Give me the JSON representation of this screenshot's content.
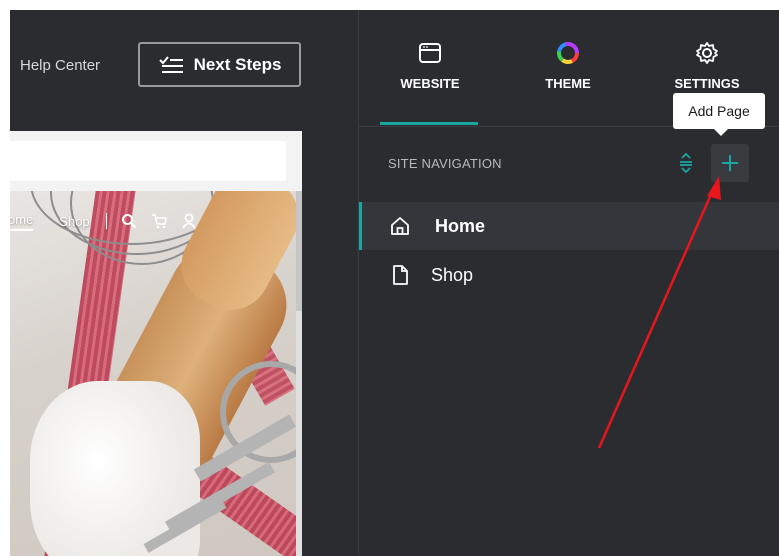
{
  "topbar": {
    "help_center": "Help Center",
    "next_steps": "Next Steps"
  },
  "preview": {
    "nav": {
      "home": "ome",
      "shop": "Shop"
    }
  },
  "panel": {
    "tabs": [
      {
        "label": "WEBSITE",
        "icon": "browser-window-icon",
        "active": true
      },
      {
        "label": "THEME",
        "icon": "color-wheel-icon",
        "active": false
      },
      {
        "label": "SETTINGS",
        "icon": "gear-icon",
        "active": false
      }
    ],
    "tooltip": "Add Page",
    "section_label": "SITE NAVIGATION",
    "pages": [
      {
        "label": "Home",
        "icon": "home-icon",
        "active": true
      },
      {
        "label": "Shop",
        "icon": "page-icon",
        "active": false
      }
    ]
  },
  "colors": {
    "accent": "#19a7a2",
    "panel_bg": "#2b2c30",
    "annotation_arrow": "#e8161c"
  }
}
